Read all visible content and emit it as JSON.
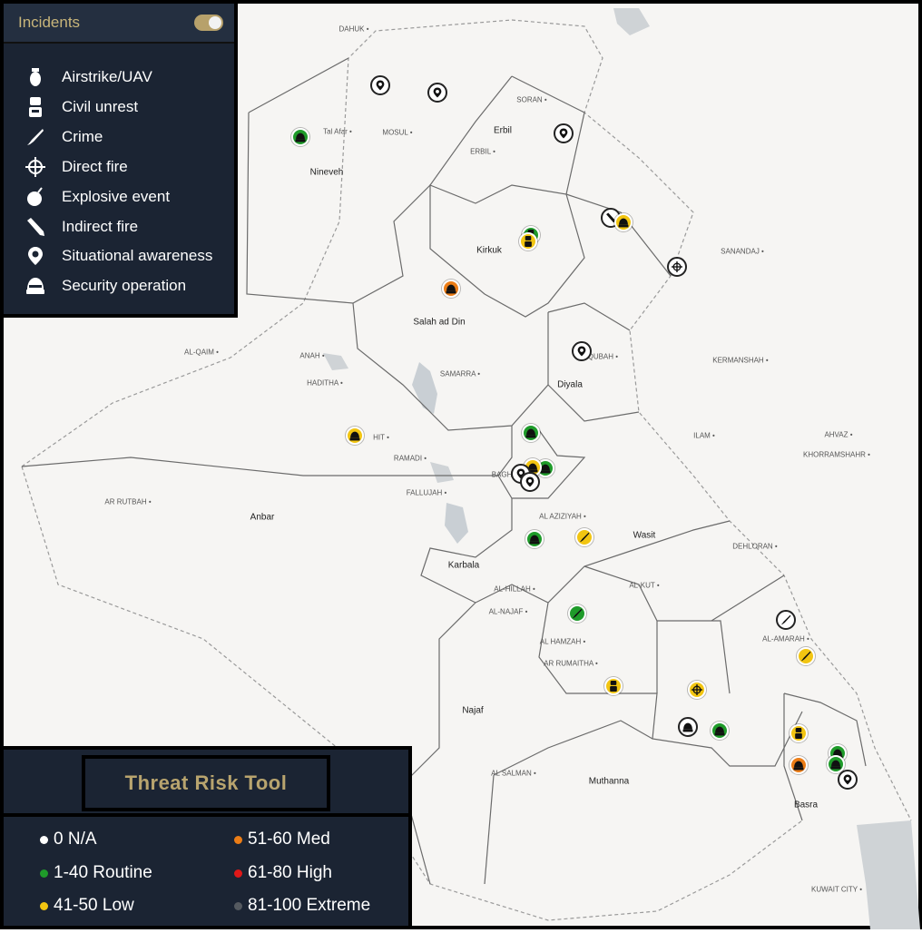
{
  "map": {
    "regions": [
      "Nineveh",
      "Kirkuk",
      "Erbil",
      "Salah ad Din",
      "Diyala",
      "Anbar",
      "Wasit",
      "Karbala",
      "Najaf",
      "Muthanna",
      "Basra"
    ],
    "small_labels": [
      "Tal Afar",
      "MOSUL",
      "DAHUK",
      "SORAN",
      "ERBIL",
      "AL-QAIM",
      "ANAH",
      "HADITHA",
      "HIT",
      "RAMADI",
      "FALLUJAH",
      "AR RUTBAH",
      "SAMARRA",
      "BAQUBAH",
      "AL AZIZIYAH",
      "AL-KUT",
      "AL-HILLAH",
      "AL-NAJAF",
      "AL HAMZAH",
      "AR RUMAITHA",
      "AL SALMAN",
      "AL-AMARAH",
      "KERMANSHAH",
      "ILAM",
      "DEHLORAN",
      "AHVAZ",
      "KHORRAMSHAHR",
      "KUWAIT CITY",
      "SANANDAJ",
      "BAGHDAD"
    ]
  },
  "incidents_panel": {
    "title": "Incidents",
    "toggle_on": true,
    "items": [
      {
        "icon": "airstrike-uav-icon",
        "label": "Airstrike/UAV"
      },
      {
        "icon": "civil-unrest-icon",
        "label": "Civil unrest"
      },
      {
        "icon": "crime-icon",
        "label": "Crime"
      },
      {
        "icon": "direct-fire-icon",
        "label": "Direct fire"
      },
      {
        "icon": "explosive-event-icon",
        "label": "Explosive event"
      },
      {
        "icon": "indirect-fire-icon",
        "label": "Indirect fire"
      },
      {
        "icon": "situational-awareness-icon",
        "label": "Situational awareness"
      },
      {
        "icon": "security-operation-icon",
        "label": "Security operation"
      }
    ]
  },
  "threat_panel": {
    "title": "Threat Risk Tool",
    "levels": [
      {
        "label": "0 N/A",
        "color": "#ffffff"
      },
      {
        "label": "1-40 Routine",
        "color": "#1f9b2a"
      },
      {
        "label": "41-50 Low",
        "color": "#f2c511"
      },
      {
        "label": "51-60 Med",
        "color": "#ec7d16"
      },
      {
        "label": "61-80 High",
        "color": "#e01818"
      },
      {
        "label": "81-100 Extreme",
        "color": "#555a60"
      }
    ]
  },
  "markers": [
    {
      "type": "situational-awareness",
      "severity": "na"
    },
    {
      "type": "situational-awareness",
      "severity": "na"
    },
    {
      "type": "security-operation",
      "severity": "routine"
    },
    {
      "type": "situational-awareness",
      "severity": "na"
    },
    {
      "type": "civil-unrest",
      "severity": "routine"
    },
    {
      "type": "civil-unrest",
      "severity": "low"
    },
    {
      "type": "indirect-fire",
      "severity": "na"
    },
    {
      "type": "security-operation",
      "severity": "low"
    },
    {
      "type": "direct-fire",
      "severity": "na"
    },
    {
      "type": "security-operation",
      "severity": "med"
    },
    {
      "type": "situational-awareness",
      "severity": "na"
    },
    {
      "type": "security-operation",
      "severity": "low"
    },
    {
      "type": "security-operation",
      "severity": "routine"
    },
    {
      "type": "security-operation",
      "severity": "routine"
    },
    {
      "type": "security-operation",
      "severity": "low"
    },
    {
      "type": "situational-awareness",
      "severity": "na"
    },
    {
      "type": "situational-awareness",
      "severity": "na"
    },
    {
      "type": "security-operation",
      "severity": "routine"
    },
    {
      "type": "crime",
      "severity": "low"
    },
    {
      "type": "crime",
      "severity": "routine"
    },
    {
      "type": "crime",
      "severity": "na"
    },
    {
      "type": "crime",
      "severity": "low"
    },
    {
      "type": "civil-unrest",
      "severity": "low"
    },
    {
      "type": "direct-fire",
      "severity": "low"
    },
    {
      "type": "security-operation",
      "severity": "na"
    },
    {
      "type": "security-operation",
      "severity": "routine"
    },
    {
      "type": "civil-unrest",
      "severity": "low"
    },
    {
      "type": "security-operation",
      "severity": "med"
    },
    {
      "type": "security-operation",
      "severity": "routine"
    },
    {
      "type": "security-operation",
      "severity": "routine"
    },
    {
      "type": "situational-awareness",
      "severity": "na"
    }
  ]
}
